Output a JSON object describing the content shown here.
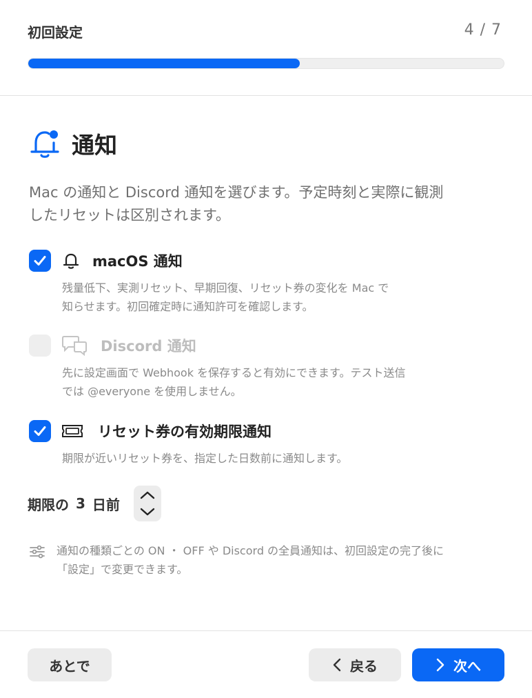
{
  "header": {
    "title": "初回設定",
    "step_counter": "4 / 7",
    "progress": 0.571,
    "accent_color": "#0a68f5"
  },
  "section": {
    "icon": "bell-badge-icon",
    "title": "通知",
    "intro_line1": "Mac の通知と Discord 通知を選びます。予定時刻と実際に観測",
    "intro_line2": "したリセットは区別されます。"
  },
  "options": [
    {
      "icon": "bell-icon",
      "label": "macOS 通知",
      "checked": true,
      "enabled": true,
      "desc_line1": "残量低下、実測リセット、早期回復、リセット券の変化を Mac で",
      "desc_line2": "知らせます。初回確定時に通知許可を確認します。"
    },
    {
      "icon": "chat-bubbles-icon",
      "label": "Discord 通知",
      "checked": false,
      "enabled": false,
      "desc_line1": "先に設定画面で Webhook を保存すると有効にできます。テスト送信",
      "desc_line2": "では @everyone を使用しません。"
    },
    {
      "icon": "ticket-icon",
      "label": "リセット券の有効期限通知",
      "checked": true,
      "enabled": true,
      "desc_line1": "期限が近いリセット券を、指定した日数前に通知します。"
    }
  ],
  "days": {
    "prefix": "期限の",
    "value": "3",
    "suffix": "日前"
  },
  "note": {
    "icon": "sliders-icon",
    "line1": "通知の種類ごとの ON ・ OFF や Discord の全員通知は、初回設定の完了後に",
    "line2": "「設定」で変更できます。"
  },
  "footer": {
    "later_label": "あとで",
    "back_label": "戻る",
    "next_label": "次へ"
  }
}
